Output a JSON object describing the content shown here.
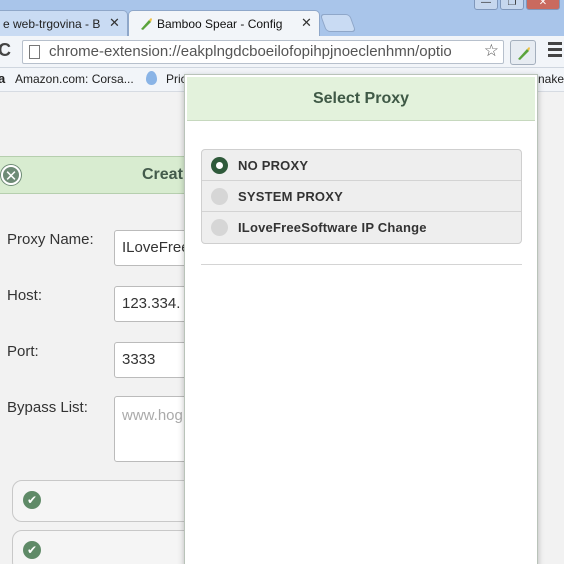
{
  "browser": {
    "tabs": [
      {
        "title": "e web-trgovina - B",
        "close": "✕",
        "active": false
      },
      {
        "title": "Bamboo Spear - Config",
        "close": "✕",
        "active": true
      }
    ],
    "window_buttons": [
      "—",
      "❐",
      "✕"
    ],
    "url": "chrome-extension://eakplngdcboeilofopihpjnoeclenhmn/optio",
    "bookmarks": [
      {
        "label": "Amazon.com: Corsa...",
        "icon": "amazon-icon"
      },
      {
        "label": "Pric",
        "icon": "droplet-icon"
      },
      {
        "label": "nake",
        "icon": ""
      }
    ]
  },
  "page": {
    "dialog": {
      "title": "Creat",
      "close_glyph": "✕",
      "fields": [
        {
          "label": "Proxy Name:",
          "value": "ILoveFree"
        },
        {
          "label": "Host:",
          "value": "123.334."
        },
        {
          "label": "Port:",
          "value": "3333"
        },
        {
          "label": "Bypass List:",
          "placeholder": "www.hog .com"
        }
      ]
    },
    "check_glyph": "✔"
  },
  "popup": {
    "title": "Select Proxy",
    "options": [
      {
        "label": "NO PROXY",
        "selected": true
      },
      {
        "label": "SYSTEM PROXY",
        "selected": false
      },
      {
        "label": "ILoveFreeSoftware IP Change",
        "selected": false
      }
    ]
  },
  "colors": {
    "popup_header_bg": "#e3f2dc",
    "selected_radio": "#2f5a3b",
    "accent_green": "#5f8a67"
  }
}
